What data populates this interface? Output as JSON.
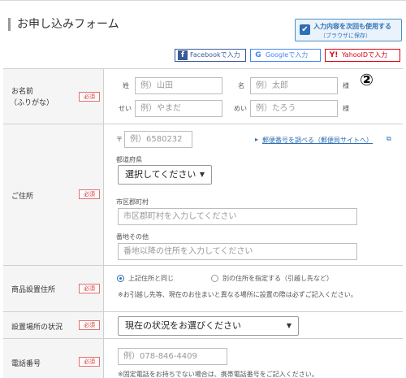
{
  "header": {
    "title": "お申し込みフォーム",
    "remember_line1": "入力内容を次回も使用する",
    "remember_line2": "（ブラウザに保存）"
  },
  "social": {
    "facebook_label": "Facebookで入力",
    "google_label": "Googleで入力",
    "yahoo_label": "YahooIDで入力"
  },
  "annotation": "②",
  "required_label": "必須",
  "name": {
    "label_line1": "お名前",
    "label_line2": "（ふりがな）",
    "sei_label": "姓",
    "sei_placeholder": "例）山田",
    "mei_label": "名",
    "mei_placeholder": "例）太郎",
    "sama": "様",
    "sei_kana_label": "せい",
    "sei_kana_placeholder": "例）やまだ",
    "mei_kana_label": "めい",
    "mei_kana_placeholder": "例）たろう",
    "sama2": "様"
  },
  "address": {
    "label": "ご住所",
    "zip_mark": "〒",
    "zip_placeholder": "例）6580232",
    "zip_link": "郵便番号を調べる（郵便局サイトへ）",
    "prefecture_label": "都道府県",
    "prefecture_value": "選択してください",
    "city_label": "市区郡町村",
    "city_placeholder": "市区郡町村を入力してください",
    "street_label": "番地その他",
    "street_placeholder": "番地以降の住所を入力してください"
  },
  "install_address": {
    "label": "商品設置住所",
    "option1": "上記住所と同じ",
    "option2": "別の住所を指定する（引越し先など）",
    "note": "※お引越し先等、現在のお住まいと異なる場所に設置の際は必ずご記入ください。"
  },
  "install_status": {
    "label": "設置場所の状況",
    "value": "現在の状況をお選びください"
  },
  "phone": {
    "label": "電話番号",
    "placeholder": "例）078-846-4409",
    "note": "※固定電話をお持ちでない場合は、携帯電話番号をご記入ください。"
  },
  "colors": {
    "accent": "#2f6fb3",
    "required": "#dd3333",
    "label_bg": "#f5f5f5"
  }
}
